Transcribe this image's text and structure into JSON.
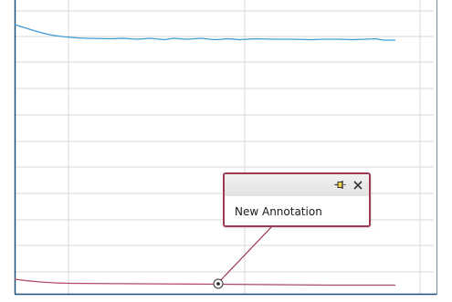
{
  "annotation": {
    "text": "New Annotation",
    "pin_icon": "pin-icon",
    "close_icon": "close-icon"
  },
  "colors": {
    "blue_series": "#3c9bd6",
    "red_series": "#b04a63",
    "annotation_border": "#9c3a52",
    "gridline": "#d9d9d9",
    "frame": "#1f4e79"
  }
}
